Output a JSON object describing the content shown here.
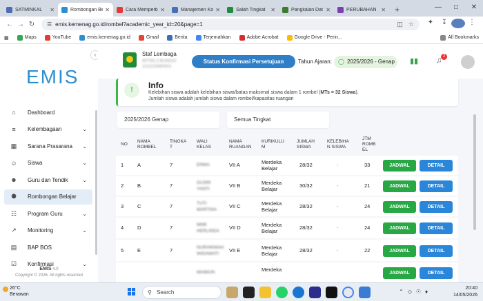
{
  "browser": {
    "tabs": [
      {
        "title": "SATMINKAL",
        "color": "#4a6fb5"
      },
      {
        "title": "Rombongan Bel",
        "color": "#2c8fd1",
        "active": true
      },
      {
        "title": "Cara Memperb",
        "color": "#e53935"
      },
      {
        "title": "Manajemen Ko",
        "color": "#4a6fb5"
      },
      {
        "title": "Salah Tingkat",
        "color": "#1e8e3e"
      },
      {
        "title": "Pangkalan Dat",
        "color": "#3a7d2c"
      },
      {
        "title": "PERUBAHAN",
        "color": "#7b3fb3"
      }
    ],
    "url": "emis.kemenag.go.id/rombel?academic_year_id=20&page=1",
    "bookmarks": [
      {
        "label": "Maps",
        "color": "#34a853"
      },
      {
        "label": "YouTube",
        "color": "#e53935"
      },
      {
        "label": "emis.kemenag.go.id",
        "color": "#2c8fd1"
      },
      {
        "label": "Gmail",
        "color": "#ea4335"
      },
      {
        "label": "Berita",
        "color": "#3b6fb6"
      },
      {
        "label": "Terjemahkan",
        "color": "#4285f4"
      },
      {
        "label": "Adobe Acrobat",
        "color": "#d32f2f"
      },
      {
        "label": "Google Drive - Perin...",
        "color": "#fbbc04"
      }
    ],
    "all_bookmarks": "All Bookmarks"
  },
  "sidebar": {
    "logo": "EMIS",
    "menu": [
      {
        "label": "Dashboard",
        "icon": "home-icon",
        "chevron": false
      },
      {
        "label": "Kelembagaan",
        "icon": "institution-icon",
        "chevron": true
      },
      {
        "label": "Sarana Prasarana",
        "icon": "building-icon",
        "chevron": true
      },
      {
        "label": "Siswa",
        "icon": "user-icon",
        "chevron": true
      },
      {
        "label": "Guru dan Tendik",
        "icon": "teacher-icon",
        "chevron": true
      },
      {
        "label": "Rombongan Belajar",
        "icon": "group-icon",
        "chevron": false,
        "active": true
      },
      {
        "label": "Program Guru",
        "icon": "program-icon",
        "chevron": true
      },
      {
        "label": "Monitoring",
        "icon": "chart-line-icon",
        "chevron": true
      },
      {
        "label": "BAP BOS",
        "icon": "calendar-icon",
        "chevron": false
      },
      {
        "label": "Konfirmasi",
        "icon": "confirm-icon",
        "chevron": true
      }
    ],
    "footer_name": "EMIS",
    "footer_version": "4.0",
    "footer_copy": "Copyright © 2026. All rights reserved"
  },
  "header": {
    "staf": "Staf Lembaga",
    "institution_line1": "MTSN 2 BUNGO",
    "institution_line2": "121115080001",
    "status_button": "Status Konfirmasi Persetujuan",
    "tahun_label": "Tahun Ajaran:",
    "tahun_value": "2025/2026 - Genap",
    "notification_count": "2"
  },
  "info": {
    "title": "Info",
    "line1a": "Kelebihan siswa adalah kelebihan siswa/batas maksimal siswa dalam 1 rombel (",
    "line1b": "MTs = 32 Siswa",
    "line1c": ").",
    "line2": "Jumlah siswa adalah jumlah siswa dalam rombel/kapasitas ruangan"
  },
  "filters": {
    "year": "2025/2026 Genap",
    "level": "Semua Tingkat"
  },
  "table": {
    "headers": {
      "no": "NO",
      "nama_rombel": [
        "NAMA",
        "ROMBEL"
      ],
      "tingkat": [
        "TINGKA",
        "T"
      ],
      "wali": [
        "WALI",
        "KELAS"
      ],
      "ruangan": [
        "NAMA",
        "RUANGAN"
      ],
      "kurikulum": [
        "KURIKULU",
        "M"
      ],
      "jumlah": [
        "JUMLAH",
        "SISWA"
      ],
      "kelebihan": [
        "KELEBIHA",
        "N SISWA"
      ],
      "jtm": [
        "JTM",
        "ROMB",
        "EL"
      ]
    },
    "rows": [
      {
        "no": "1",
        "rombel": "A",
        "tingkat": "7",
        "wali": "ERMA",
        "ruangan": "VII A",
        "kurikulum": [
          "Merdeka",
          "Belajar"
        ],
        "jumlah": "28/32",
        "kelebihan": "-",
        "jtm": "33"
      },
      {
        "no": "2",
        "rombel": "B",
        "tingkat": "7",
        "wali": "GUSRI YANTI",
        "ruangan": "VII B",
        "kurikulum": [
          "Merdeka",
          "Belajar"
        ],
        "jumlah": "30/32",
        "kelebihan": "-",
        "jtm": "21"
      },
      {
        "no": "3",
        "rombel": "C",
        "tingkat": "7",
        "wali": "TUTI MARTINA",
        "ruangan": "VII C",
        "kurikulum": [
          "Merdeka",
          "Belajar"
        ],
        "jumlah": "28/32",
        "kelebihan": "-",
        "jtm": "24"
      },
      {
        "no": "4",
        "rombel": "D",
        "tingkat": "7",
        "wali": "MIMI HERLINDA",
        "ruangan": "VII D",
        "kurikulum": [
          "Merdeka",
          "Belajar"
        ],
        "jumlah": "28/32",
        "kelebihan": "-",
        "jtm": "24"
      },
      {
        "no": "5",
        "rombel": "E",
        "tingkat": "7",
        "wali": "NURHIKMAH WIDAWATI",
        "ruangan": "VII E",
        "kurikulum": [
          "Merdeka",
          "Belajar"
        ],
        "jumlah": "28/32",
        "kelebihan": "-",
        "jtm": "22"
      },
      {
        "no": "",
        "rombel": "",
        "tingkat": "",
        "wali": "MAIMUN",
        "ruangan": "",
        "kurikulum": [
          "Merdeka",
          ""
        ],
        "jumlah": "",
        "kelebihan": "",
        "jtm": ""
      }
    ],
    "btn_jadwal": "JADWAL",
    "btn_detail": "DETAIL"
  },
  "taskbar": {
    "temperature": "26°C",
    "weather": "Berawan",
    "search": "Search",
    "time": "20:40",
    "date": "14/05/2026"
  }
}
